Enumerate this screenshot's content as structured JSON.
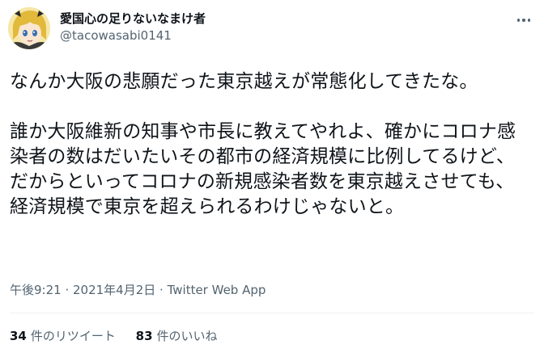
{
  "user": {
    "display_name": "愛国心の足りないなまけ者",
    "handle": "@tacowasabi0141",
    "avatar": "anime-avatar-icon"
  },
  "tweet": {
    "paragraph1": "なんか大阪の悲願だった東京越えが常態化してきたな。",
    "paragraph2": "誰か大阪維新の知事や市長に教えてやれよ、確かにコロナ感染者の数はだいたいその都市の経済規模に比例してるけど、だからといってコロナの新規感染者数を東京越えさせても、経済規模で東京を超えられるわけじゃないと。"
  },
  "meta": {
    "time": "午後9:21",
    "separator1": " · ",
    "date": "2021年4月2日",
    "separator2": " · ",
    "source": "Twitter Web App"
  },
  "stats": {
    "retweets_count": "34",
    "retweets_label": "件のリツイート",
    "likes_count": "83",
    "likes_label": "件のいいね"
  },
  "icons": {
    "more": "more-horizontal-icon"
  },
  "colors": {
    "text_primary": "#0f1419",
    "text_secondary": "#536471",
    "divider": "#eff3f4"
  }
}
